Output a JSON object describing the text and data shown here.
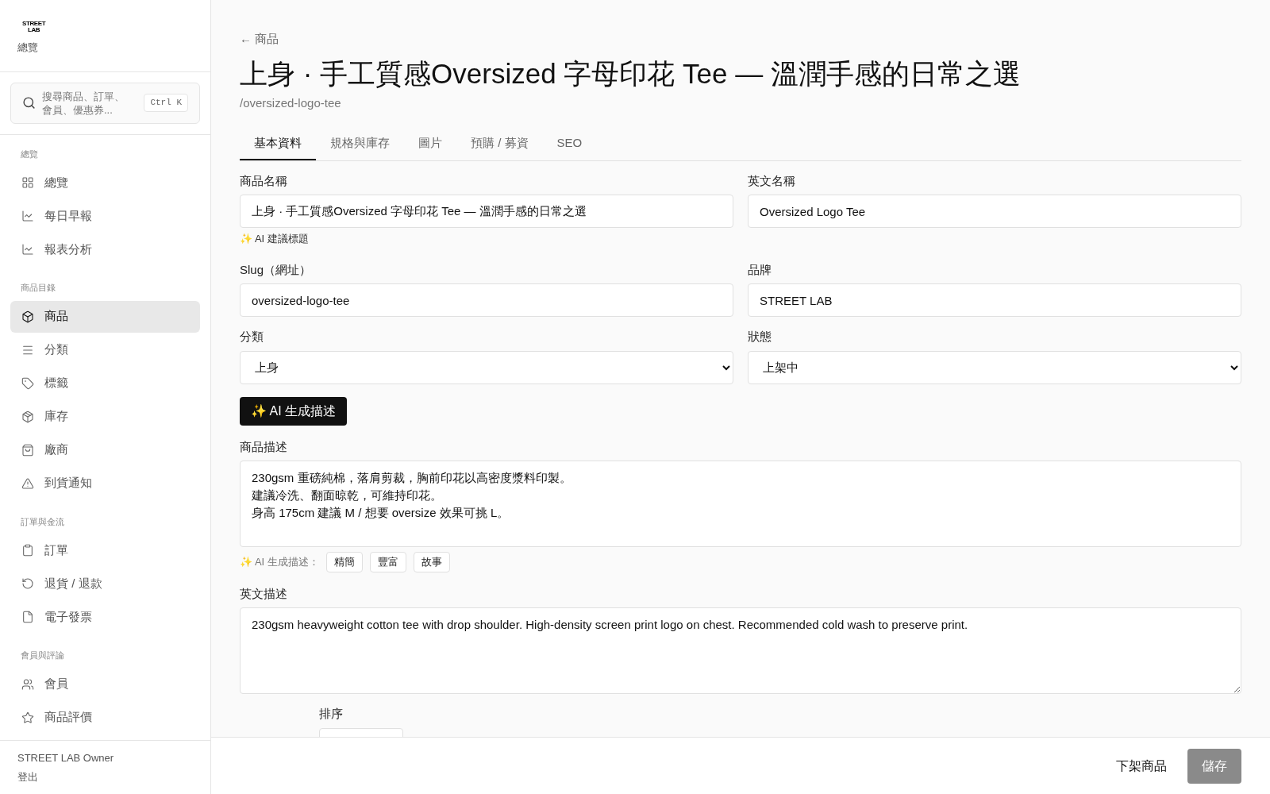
{
  "sidebar": {
    "logo": {
      "line1": "STREET",
      "line2": "LAB"
    },
    "subtitle": "總覽",
    "search": {
      "placeholder": "搜尋商品、訂單、會員、優惠券...",
      "shortcut": "Ctrl K"
    },
    "sections": [
      {
        "title": "總覽",
        "items": [
          {
            "label": "總覽",
            "kind": "grid",
            "selected": false
          },
          {
            "label": "每日早報",
            "kind": "chart",
            "selected": false
          },
          {
            "label": "報表分析",
            "kind": "chart",
            "selected": false
          }
        ]
      },
      {
        "title": "商品目錄",
        "items": [
          {
            "label": "商品",
            "kind": "box",
            "selected": true
          },
          {
            "label": "分類",
            "kind": "list",
            "selected": false
          },
          {
            "label": "標籤",
            "kind": "tag",
            "selected": false
          },
          {
            "label": "庫存",
            "kind": "package",
            "selected": false
          },
          {
            "label": "廠商",
            "kind": "bag",
            "selected": false
          },
          {
            "label": "到貨通知",
            "kind": "alert",
            "selected": false
          }
        ]
      },
      {
        "title": "訂單與金流",
        "items": [
          {
            "label": "訂單",
            "kind": "clipboard",
            "selected": false
          },
          {
            "label": "退貨 / 退款",
            "kind": "undo",
            "selected": false
          },
          {
            "label": "電子發票",
            "kind": "file",
            "selected": false
          }
        ]
      },
      {
        "title": "會員與評論",
        "items": [
          {
            "label": "會員",
            "kind": "users",
            "selected": false
          },
          {
            "label": "商品評價",
            "kind": "star",
            "selected": false
          }
        ]
      }
    ],
    "user": {
      "name": "STREET LAB Owner",
      "logout": "登出"
    }
  },
  "breadcrumb": "← 商品",
  "title": "上身 · 手工質感Oversized 字母印花 Tee — 溫潤手感的日常之選",
  "slug_path": "/oversized-logo-tee",
  "tabs": [
    {
      "label": "基本資料",
      "selected": true
    },
    {
      "label": "規格與庫存",
      "selected": false
    },
    {
      "label": "圖片",
      "selected": false
    },
    {
      "label": "預購 / 募資",
      "selected": false
    },
    {
      "label": "SEO",
      "selected": false
    }
  ],
  "fields": {
    "name": {
      "label": "商品名稱",
      "value": "上身 · 手工質感Oversized 字母印花 Tee — 溫潤手感的日常之選",
      "hint": "✨ AI 建議標題"
    },
    "english_name": {
      "label": "英文名稱",
      "value": "Oversized Logo Tee"
    },
    "slug": {
      "label": "Slug（網址）",
      "value": "oversized-logo-tee"
    },
    "brand": {
      "label": "品牌",
      "value": "STREET LAB"
    },
    "category": {
      "label": "分類",
      "value": "上身"
    },
    "status": {
      "label": "狀態",
      "value": "上架中"
    }
  },
  "ai_button": "✨ AI 生成描述",
  "description": {
    "label": "商品描述",
    "lines": [
      "230gsm 重磅純棉，落肩剪裁，胸前印花以高密度漿料印製。",
      "建議冷洗、翻面晾乾，可維持印花。",
      "身高 175cm 建議 M / 想要 oversize 效果可挑 L。"
    ],
    "ai_label": "✨ AI 生成描述：",
    "styles": [
      "精簡",
      "豐富",
      "故事"
    ]
  },
  "english_description": {
    "label": "英文描述",
    "value": "230gsm heavyweight cotton tee with drop shoulder. High-density screen print logo on chest. Recommended cold wash to preserve print."
  },
  "sort": {
    "label": "排序"
  },
  "footer": {
    "unpublish": "下架商品",
    "save": "儲存"
  }
}
